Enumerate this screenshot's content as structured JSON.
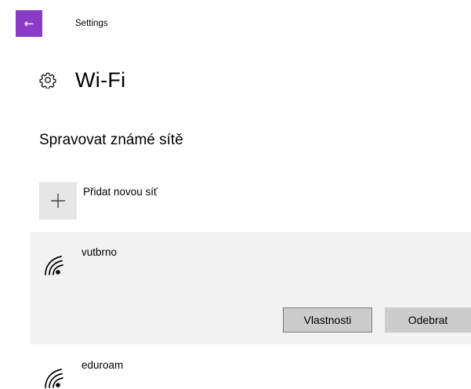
{
  "titlebar": {
    "back_icon": "back-arrow-icon",
    "app_title": "Settings",
    "accent": "#8a3cc9"
  },
  "header": {
    "icon": "gear-icon",
    "title": "Wi-Fi"
  },
  "section": {
    "title": "Spravovat známé sítě"
  },
  "add_network": {
    "icon": "plus-icon",
    "label": "Přidat novou síť"
  },
  "networks": [
    {
      "name": "vutbrno",
      "icon": "wifi-icon",
      "selected": true,
      "buttons": {
        "properties": "Vlastnosti",
        "remove": "Odebrat"
      }
    },
    {
      "name": "eduroam",
      "icon": "wifi-icon",
      "selected": false
    }
  ]
}
